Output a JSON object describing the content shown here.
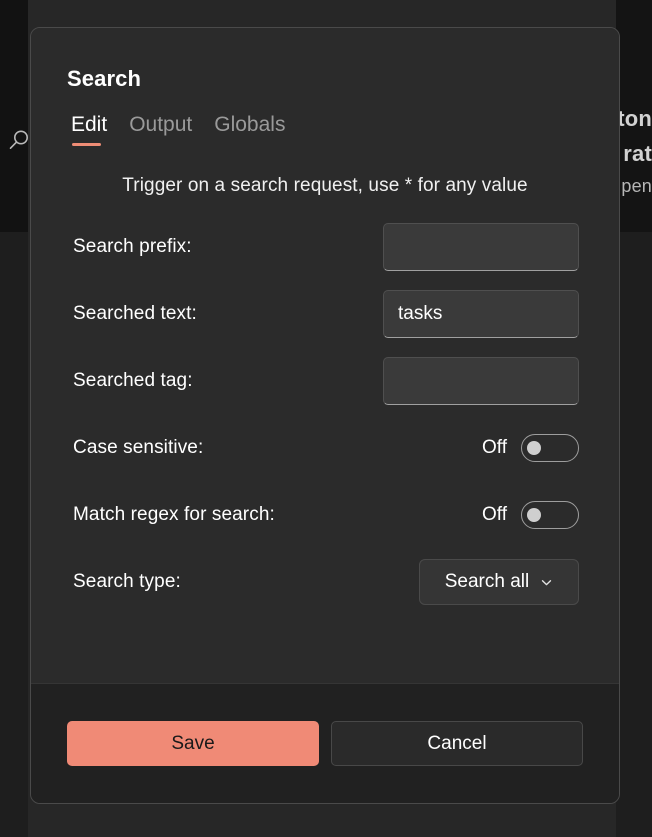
{
  "background": {
    "search_icon": "search-icon",
    "text_fragments": [
      "ton",
      "rat",
      "pen"
    ]
  },
  "modal": {
    "title": "Search",
    "tabs": [
      {
        "label": "Edit",
        "active": true
      },
      {
        "label": "Output",
        "active": false
      },
      {
        "label": "Globals",
        "active": false
      }
    ],
    "description": "Trigger on a search request, use * for any value",
    "accent_color": "#f08a76",
    "fields": [
      {
        "label": "Search prefix:",
        "type": "text",
        "value": "",
        "placeholder": ""
      },
      {
        "label": "Searched text:",
        "type": "text",
        "value": "tasks",
        "placeholder": ""
      },
      {
        "label": "Searched tag:",
        "type": "text",
        "value": "",
        "placeholder": ""
      },
      {
        "label": "Case sensitive:",
        "type": "toggle",
        "state_label": "Off",
        "checked": false
      },
      {
        "label": "Match regex for search:",
        "type": "toggle",
        "state_label": "Off",
        "checked": false
      },
      {
        "label": "Search type:",
        "type": "select",
        "value": "Search all",
        "chevron": "chevron-down-icon"
      }
    ],
    "footer": {
      "save_label": "Save",
      "cancel_label": "Cancel"
    }
  }
}
